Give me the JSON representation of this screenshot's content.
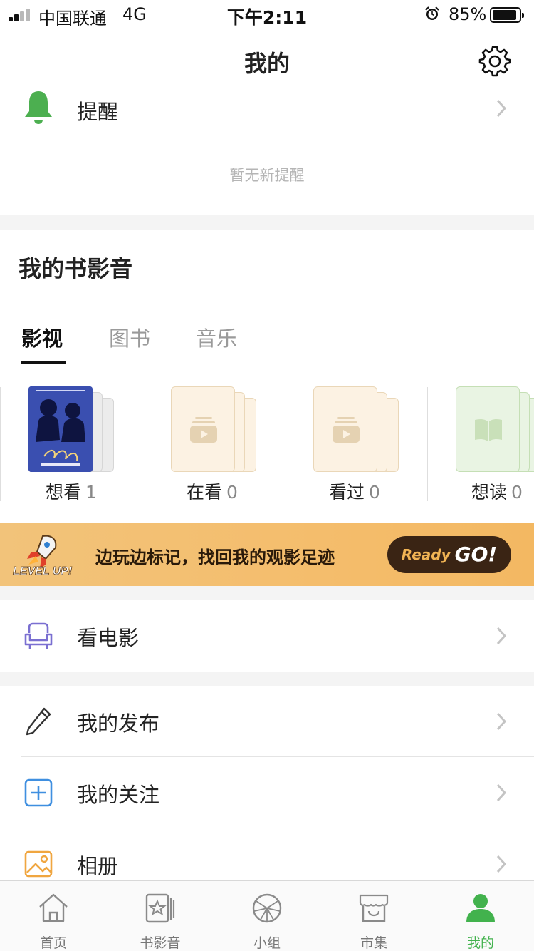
{
  "status_bar": {
    "carrier": "中国联通",
    "network": "4G",
    "time": "下午2:11",
    "battery": "85%",
    "battery_level": 0.85
  },
  "nav": {
    "title": "我的",
    "settings_icon": "gear-icon"
  },
  "reminder": {
    "label": "提醒",
    "empty_text": "暂无新提醒",
    "icon": "bell-icon",
    "icon_color": "#4caf50"
  },
  "media": {
    "title": "我的书影音",
    "tabs": [
      {
        "label": "影视",
        "active": true
      },
      {
        "label": "图书",
        "active": false
      },
      {
        "label": "音乐",
        "active": false
      }
    ],
    "shelves": [
      {
        "label": "想看",
        "count": "1",
        "has_poster": true
      },
      {
        "label": "在看",
        "count": "0"
      },
      {
        "label": "看过",
        "count": "0"
      },
      {
        "label": "想读",
        "count": "0"
      }
    ]
  },
  "banner": {
    "badge": "LEVEL UP!",
    "text": "边玩边标记，找回我的观影足迹",
    "button_ready": "Ready",
    "button_go": "GO!"
  },
  "menu": {
    "movies": "看电影",
    "my_posts": "我的发布",
    "my_follows": "我的关注",
    "album": "相册"
  },
  "tab_bar": {
    "items": [
      {
        "label": "首页",
        "icon": "home-icon"
      },
      {
        "label": "书影音",
        "icon": "media-icon"
      },
      {
        "label": "小组",
        "icon": "group-icon"
      },
      {
        "label": "市集",
        "icon": "market-icon"
      },
      {
        "label": "我的",
        "icon": "profile-icon",
        "active": true
      }
    ],
    "active_color": "#42b24d"
  }
}
